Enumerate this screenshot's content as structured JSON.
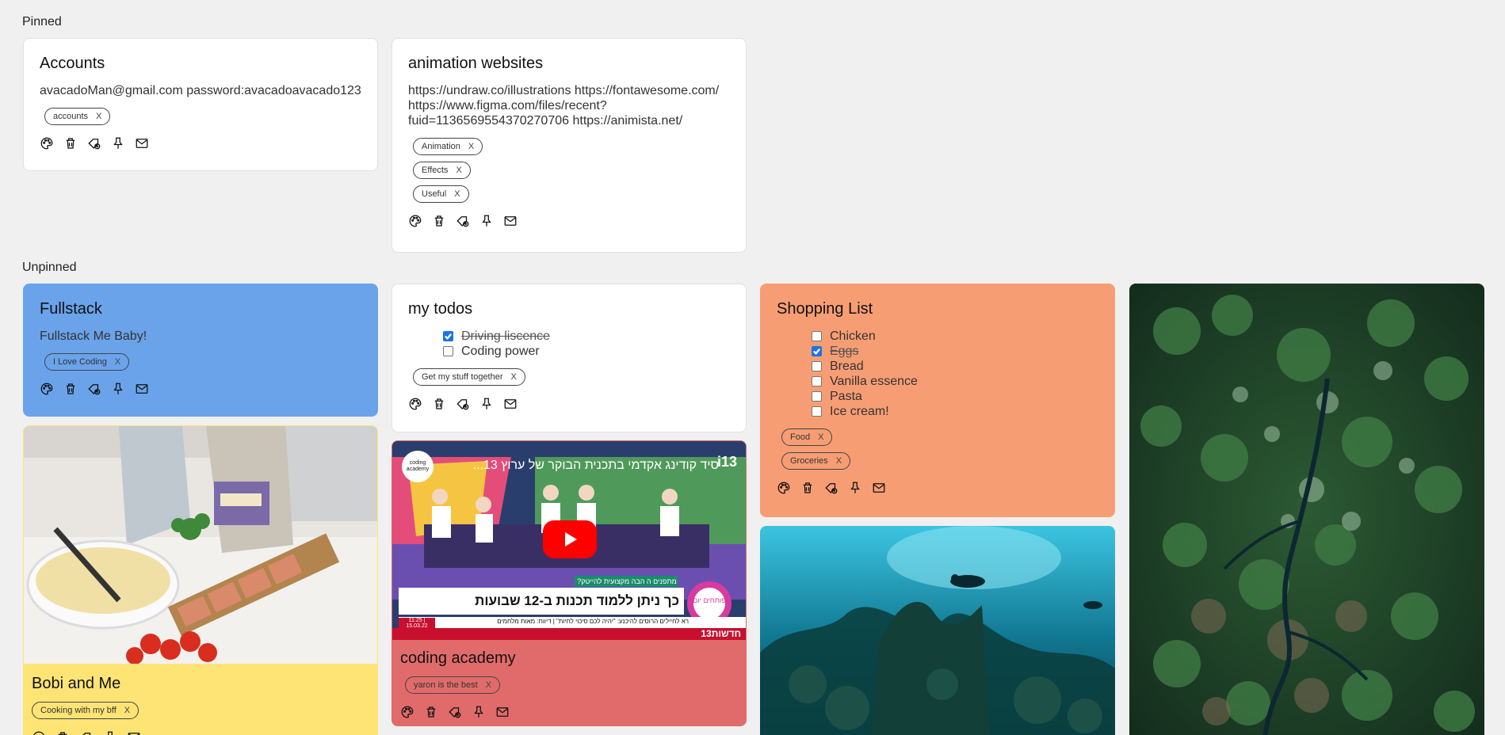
{
  "sections": {
    "pinned": "Pinned",
    "unpinned": "Unpinned"
  },
  "notes": {
    "accounts": {
      "title": "Accounts",
      "text": "avacadoMan@gmail.com password:avacadoavacado123",
      "labels": [
        "accounts"
      ]
    },
    "animation": {
      "title": "animation websites",
      "text": "https://undraw.co/illustrations https://fontawesome.com/ https://www.figma.com/files/recent?fuid=1136569554370270706 https://animista.net/",
      "labels": [
        "Animation",
        "Effects",
        "Useful"
      ]
    },
    "fullstack": {
      "title": "Fullstack",
      "text": "Fullstack Me Baby!",
      "labels": [
        "I Love Coding"
      ],
      "color": "#6aa3ea"
    },
    "todos": {
      "title": "my todos",
      "items": [
        {
          "text": "Driving liscence",
          "done": true
        },
        {
          "text": "Coding power",
          "done": false
        }
      ],
      "labels": [
        "Get my stuff together"
      ]
    },
    "shopping": {
      "title": "Shopping List",
      "items": [
        {
          "text": "Chicken",
          "done": false
        },
        {
          "text": "Eggs",
          "done": true
        },
        {
          "text": "Bread",
          "done": false
        },
        {
          "text": "Vanilla essence",
          "done": false
        },
        {
          "text": "Pasta",
          "done": false
        },
        {
          "text": "Ice cream!",
          "done": false
        }
      ],
      "labels": [
        "Food",
        "Groceries"
      ],
      "color": "#f79d74"
    },
    "bobi": {
      "title": "Bobi and Me",
      "labels": [
        "Cooking with my bff"
      ],
      "color": "#fde475"
    },
    "coding": {
      "title": "coding academy",
      "labels": [
        "yaron is the best"
      ],
      "color": "#e16b6b",
      "video": {
        "title": "סיד קודינג אקדמי בתכנית הבוקר של ערוץ 13...",
        "channel_badge": "coding academy",
        "headline": "כך ניתן ללמוד תכנות ב-12 שבועות",
        "tag": "מתפנים ה הבה מקצועית להייטק?",
        "show": "פותחים יום",
        "news": "חדשות13",
        "ticker": "רא לחיילים הרוסים להיכנע: \"יהיה לכם סיכוי לחיות\" | דיווח: מאות מלחמים",
        "time": "11:25 | 15.03.22"
      }
    }
  },
  "icons": [
    "palette-icon",
    "trash-icon",
    "label-add-icon",
    "pin-icon",
    "mail-icon"
  ],
  "label_close": "X"
}
